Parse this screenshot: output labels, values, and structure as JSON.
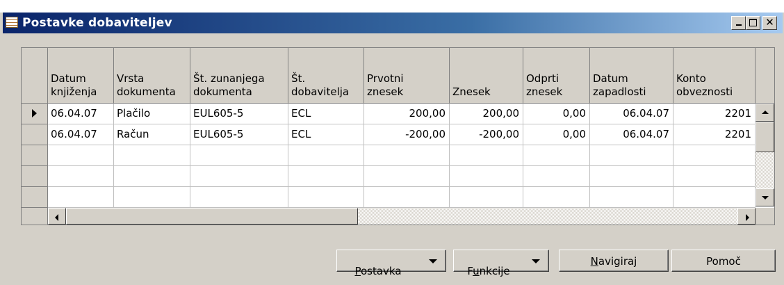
{
  "window": {
    "title": "Postavke dobaviteljev",
    "controls": [
      "minimize",
      "maximize",
      "close"
    ]
  },
  "table": {
    "columns": [
      {
        "line1": "Datum",
        "line2": "knjiženja"
      },
      {
        "line1": "Vrsta",
        "line2": "dokumenta"
      },
      {
        "line1": "Št. zunanjega",
        "line2": "dokumenta"
      },
      {
        "line1": "Št.",
        "line2": "dobavitelja"
      },
      {
        "line1": "Prvotni",
        "line2": "znesek"
      },
      {
        "line1": "",
        "line2": "Znesek"
      },
      {
        "line1": "Odprti",
        "line2": "znesek"
      },
      {
        "line1": "Datum",
        "line2": "zapadlosti"
      },
      {
        "line1": "Konto",
        "line2": "obveznosti"
      }
    ],
    "rows": [
      {
        "cells": [
          "06.04.07",
          "Plačilo",
          "EUL605-5",
          "ECL",
          "200,00",
          "200,00",
          "0,00",
          "06.04.07",
          "2201"
        ],
        "selected": true
      },
      {
        "cells": [
          "06.04.07",
          "Račun",
          "EUL605-5",
          "ECL",
          "-200,00",
          "-200,00",
          "0,00",
          "06.04.07",
          "2201"
        ],
        "selected": false
      },
      {
        "cells": [
          "",
          "",
          "",
          "",
          "",
          "",
          "",
          "",
          ""
        ],
        "selected": false
      },
      {
        "cells": [
          "",
          "",
          "",
          "",
          "",
          "",
          "",
          "",
          ""
        ],
        "selected": false
      },
      {
        "cells": [
          "",
          "",
          "",
          "",
          "",
          "",
          "",
          "",
          ""
        ],
        "selected": false
      }
    ]
  },
  "buttons": {
    "postavka": {
      "pre": "",
      "ul": "P",
      "post": "ostavka"
    },
    "funkcije": {
      "pre": "F",
      "ul": "u",
      "post": "nkcije"
    },
    "navigiraj": {
      "pre": "",
      "ul": "N",
      "post": "avigiraj"
    },
    "pomoc": {
      "pre": "",
      "ul": "",
      "post": "Pomoč"
    }
  },
  "colors": {
    "titlebar_start": "#0a246a",
    "titlebar_end": "#a6caf0",
    "face": "#d4d0c8"
  },
  "icons": {
    "title": "table-icon",
    "row_pointer": "row-pointer-icon"
  }
}
